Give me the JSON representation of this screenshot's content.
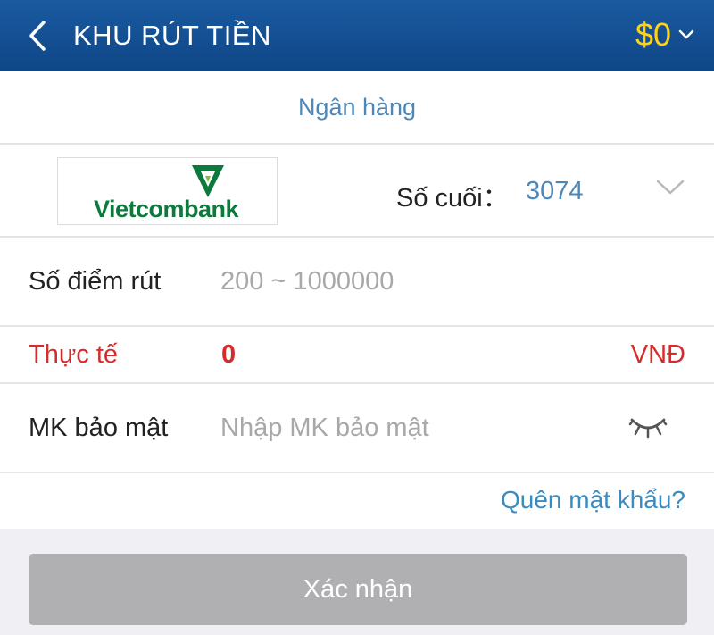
{
  "header": {
    "title": "KHU RÚT TIỀN",
    "balance": "$0",
    "back_icon": "chevron-left-icon",
    "balance_dropdown_icon": "chevron-down-icon"
  },
  "bank_tab": {
    "label": "Ngân hàng"
  },
  "bank_selector": {
    "bank_name": "Vietcombank",
    "account_label": "Số cuối：",
    "account_last_digits": "3074",
    "dropdown_icon": "chevron-down-icon"
  },
  "form": {
    "amount": {
      "label": "Số điểm rút",
      "value": "",
      "placeholder": "200 ~ 1000000"
    },
    "actual": {
      "label": "Thực tế",
      "value": "0",
      "unit": "VNĐ"
    },
    "password": {
      "label": "MK bảo mật",
      "value": "",
      "placeholder": "Nhập MK bảo mật",
      "toggle_icon": "eye-closed-icon"
    },
    "forgot_password": "Quên mật khẩu?"
  },
  "confirm_button": "Xác nhận",
  "colors": {
    "header_bg": "#0f4687",
    "balance": "#ffd21a",
    "accent_blue": "#4d87b8",
    "link_blue": "#3a8bc2",
    "alert_red": "#d62b2b",
    "bank_green": "#0d7a3d",
    "button_disabled": "#b0b0b3"
  }
}
